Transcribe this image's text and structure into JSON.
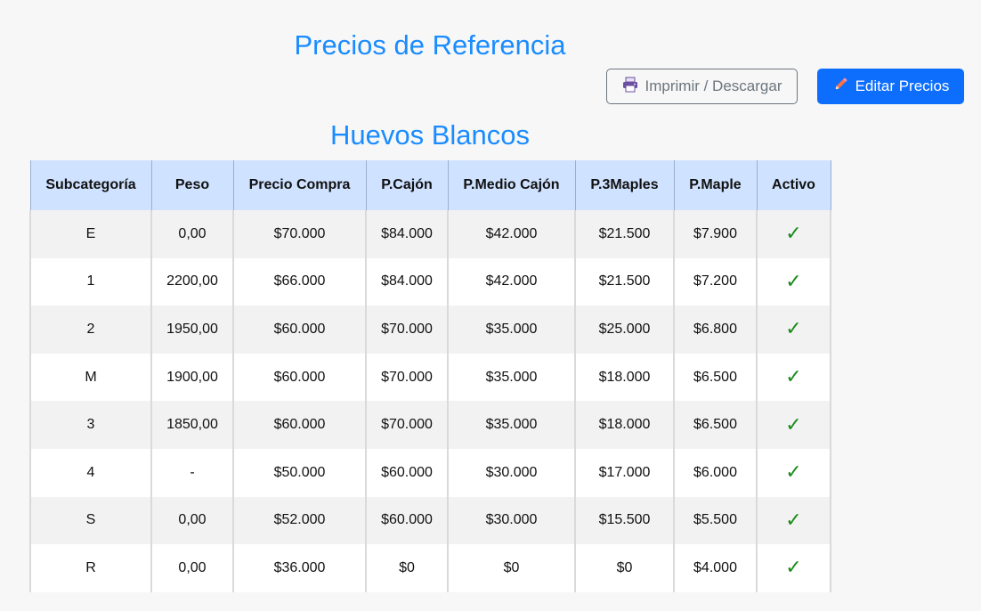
{
  "page": {
    "title": "Precios de Referencia",
    "section_title": "Huevos Blancos"
  },
  "toolbar": {
    "print_label": "Imprimir / Descargar",
    "print_icon": "printer-icon",
    "edit_label": "Editar Precios",
    "edit_icon": "pencil-icon"
  },
  "colors": {
    "title": "#1a8cff",
    "header_bg": "#cfe2ff",
    "primary_button": "#0d6efd",
    "check": "#1a8a1a"
  },
  "table": {
    "headers": [
      "Subcategoría",
      "Peso",
      "Precio Compra",
      "P.Cajón",
      "P.Medio Cajón",
      "P.3Maples",
      "P.Maple",
      "Activo"
    ],
    "rows": [
      [
        "E",
        "0,00",
        "$70.000",
        "$84.000",
        "$42.000",
        "$21.500",
        "$7.900",
        "✓"
      ],
      [
        "1",
        "2200,00",
        "$66.000",
        "$84.000",
        "$42.000",
        "$21.500",
        "$7.200",
        "✓"
      ],
      [
        "2",
        "1950,00",
        "$60.000",
        "$70.000",
        "$35.000",
        "$25.000",
        "$6.800",
        "✓"
      ],
      [
        "M",
        "1900,00",
        "$60.000",
        "$70.000",
        "$35.000",
        "$18.000",
        "$6.500",
        "✓"
      ],
      [
        "3",
        "1850,00",
        "$60.000",
        "$70.000",
        "$35.000",
        "$18.000",
        "$6.500",
        "✓"
      ],
      [
        "4",
        "-",
        "$50.000",
        "$60.000",
        "$30.000",
        "$17.000",
        "$6.000",
        "✓"
      ],
      [
        "S",
        "0,00",
        "$52.000",
        "$60.000",
        "$30.000",
        "$15.500",
        "$5.500",
        "✓"
      ],
      [
        "R",
        "0,00",
        "$36.000",
        "$0",
        "$0",
        "$0",
        "$4.000",
        "✓"
      ]
    ]
  }
}
